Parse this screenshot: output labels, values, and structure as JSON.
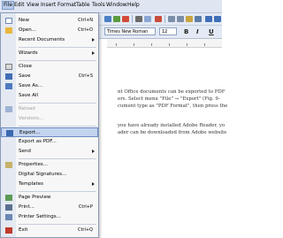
{
  "menubar": {
    "items": [
      "File",
      "Edit",
      "View",
      "Insert",
      "Format",
      "Table",
      "Tools",
      "Window",
      "Help"
    ]
  },
  "toolbar": {
    "font_name": "Times New Roman",
    "font_size": "12",
    "bold_label": "B",
    "italic_label": "I",
    "underline_label": "U"
  },
  "document": {
    "lines": [
      "nt Office documents can be exported to PDF",
      "ers. Select menu \"File\" → \"Export\" (Fig. 9-",
      "cument type as \"PDF Format\", then press the",
      "you have already installed Adobe Reader, yo",
      "ader can be downloaded from Adobe website"
    ]
  },
  "file_menu": {
    "items": [
      {
        "label": "New",
        "shortcut": "Ctrl+N",
        "icon": "new-icon",
        "disabled": false
      },
      {
        "label": "Open...",
        "shortcut": "Ctrl+O",
        "icon": "open-folder-icon",
        "disabled": false
      },
      {
        "label": "Recent Documents",
        "shortcut": "",
        "icon": "",
        "disabled": false,
        "submenu": true
      },
      {
        "label": "Wizards",
        "shortcut": "",
        "icon": "",
        "disabled": false,
        "submenu": true
      },
      {
        "label": "Close",
        "shortcut": "",
        "icon": "close-icon",
        "disabled": false
      },
      {
        "label": "Save",
        "shortcut": "Ctrl+S",
        "icon": "save-icon",
        "disabled": false
      },
      {
        "label": "Save As...",
        "shortcut": "",
        "icon": "save-as-icon",
        "disabled": false
      },
      {
        "label": "Save All",
        "shortcut": "",
        "icon": "",
        "disabled": false
      },
      {
        "label": "Reload",
        "shortcut": "",
        "icon": "reload-icon",
        "disabled": true
      },
      {
        "label": "Versions...",
        "shortcut": "",
        "icon": "",
        "disabled": true
      },
      {
        "label": "Export...",
        "shortcut": "",
        "icon": "export-icon",
        "disabled": false
      },
      {
        "label": "Export as PDF...",
        "shortcut": "",
        "icon": "",
        "disabled": false
      },
      {
        "label": "Send",
        "shortcut": "",
        "icon": "",
        "disabled": false,
        "submenu": true
      },
      {
        "label": "Properties...",
        "shortcut": "",
        "icon": "properties-icon",
        "disabled": false
      },
      {
        "label": "Digital Signatures...",
        "shortcut": "",
        "icon": "",
        "disabled": false
      },
      {
        "label": "Templates",
        "shortcut": "",
        "icon": "",
        "disabled": false,
        "submenu": true
      },
      {
        "label": "Page Preview",
        "shortcut": "",
        "icon": "page-preview-icon",
        "disabled": false
      },
      {
        "label": "Print...",
        "shortcut": "Ctrl+P",
        "icon": "print-icon",
        "disabled": false
      },
      {
        "label": "Printer Settings...",
        "shortcut": "",
        "icon": "printer-settings-icon",
        "disabled": false
      },
      {
        "label": "Exit",
        "shortcut": "Ctrl+Q",
        "icon": "exit-icon",
        "disabled": false
      }
    ],
    "highlighted": "Export..."
  },
  "colors": {
    "menu_highlight": "#c3d4ee",
    "toolbar_bg": "#e3eaf5"
  }
}
